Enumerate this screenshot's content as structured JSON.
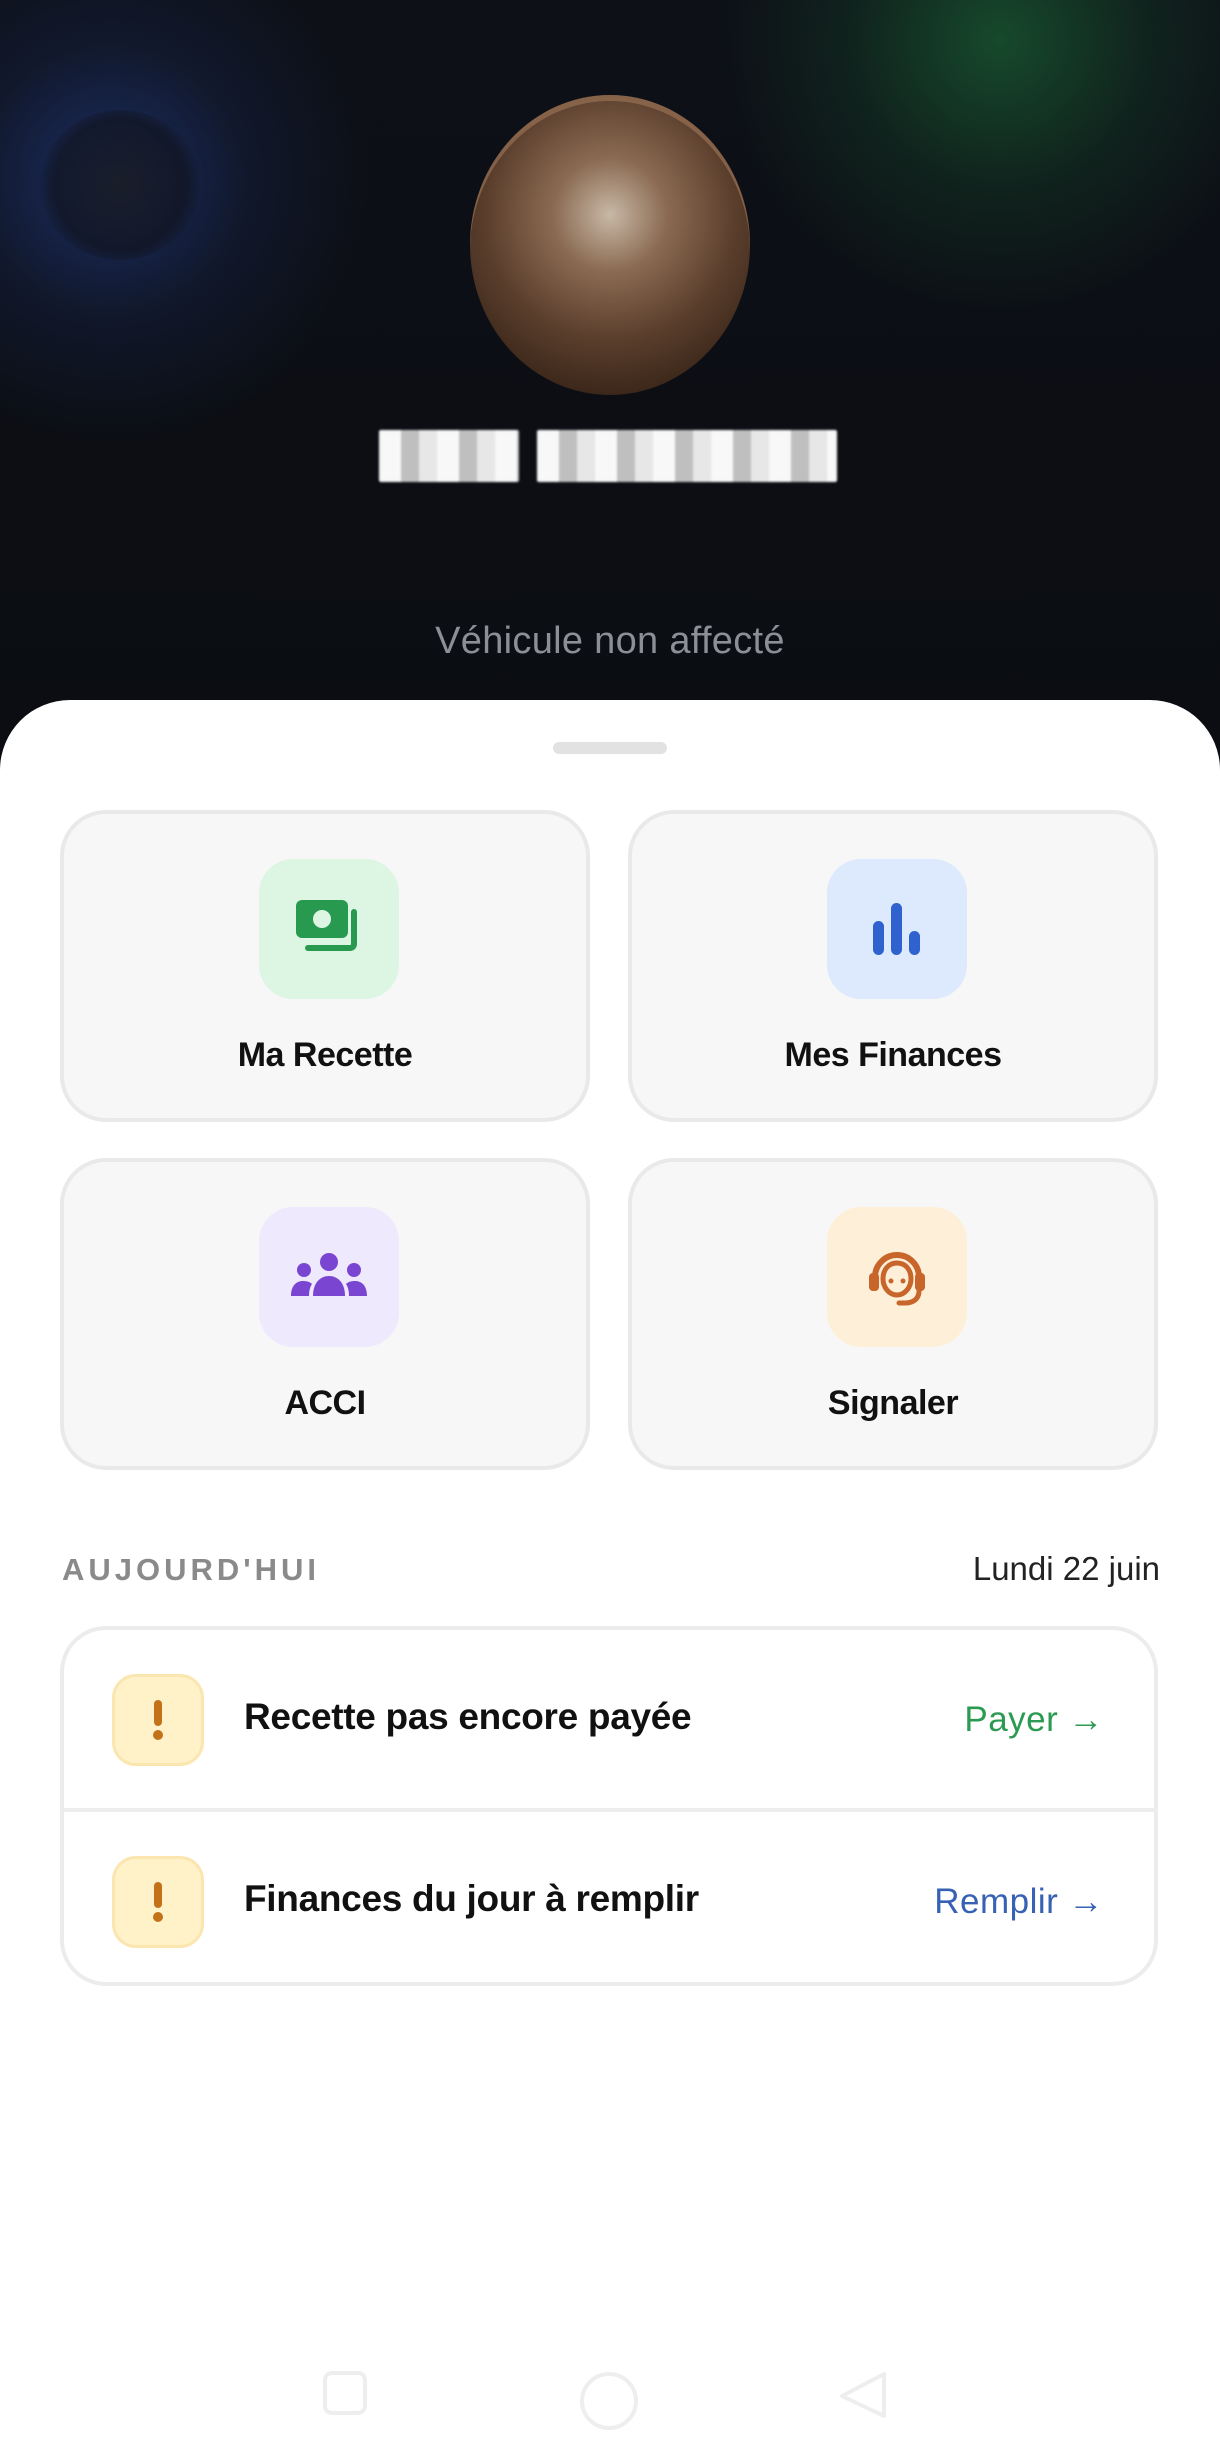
{
  "profile": {
    "name": "",
    "vehicle_status": "Véhicule non affecté"
  },
  "tiles": [
    {
      "label": "Ma Recette",
      "icon": "money-icon",
      "bg": "#ddf6e3",
      "color": "#279a4f"
    },
    {
      "label": "Mes Finances",
      "icon": "bar-chart-icon",
      "bg": "#dde9fd",
      "color": "#2f62cf"
    },
    {
      "label": "ACCI",
      "icon": "group-icon",
      "bg": "#eee9fd",
      "color": "#7a46d1"
    },
    {
      "label": "Signaler",
      "icon": "support-agent-icon",
      "bg": "#feefd9",
      "color": "#c7652a"
    }
  ],
  "today": {
    "title": "AUJOURD'HUI",
    "date": "Lundi 22 juin",
    "tasks": [
      {
        "text": "Recette pas encore payée",
        "action": "Payer →",
        "action_color": "#2b9a52"
      },
      {
        "text": "Finances du jour à remplir",
        "action": "Remplir →",
        "action_color": "#3661b4"
      }
    ]
  },
  "colors": {
    "warning_bg": "#fff1c8",
    "warning_icon": "#c47219"
  }
}
